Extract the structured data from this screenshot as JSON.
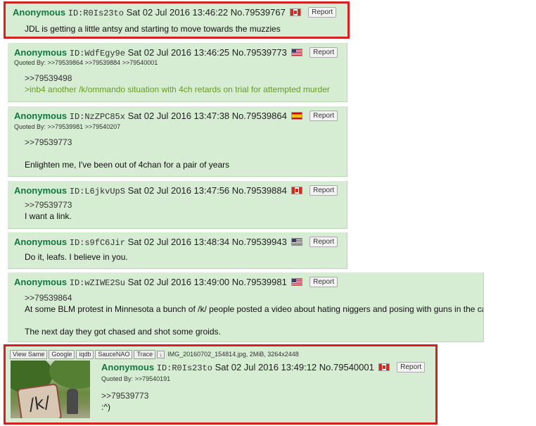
{
  "report_label": "Report",
  "quoted_by_label": "Quoted By:",
  "posts": [
    {
      "name": "Anonymous",
      "id": "ID:R0Is23to",
      "date": "Sat 02 Jul 2016 13:46:22",
      "no": "No.79539767",
      "flag": "canada-flag-icon",
      "lines": [
        "JDL is getting a little antsy and starting to move towards the muzzies"
      ]
    },
    {
      "name": "Anonymous",
      "id": "ID:WdfEgy9e",
      "date": "Sat 02 Jul 2016 13:46:25",
      "no": "No.79539773",
      "flag": "us-flag-icon",
      "quoted_by": [
        ">>79539864",
        ">>79539884",
        ">>79540001"
      ],
      "lines": [
        ">>79539498",
        ">inb4 another /k/ommando situation with 4ch retards on trial for attempted murder"
      ]
    },
    {
      "name": "Anonymous",
      "id": "ID:NzZPC85x",
      "date": "Sat 02 Jul 2016 13:47:38",
      "no": "No.79539864",
      "flag": "spain-flag-icon",
      "quoted_by": [
        ">>79539981",
        ">>79540207"
      ],
      "lines": [
        ">>79539773",
        "Enlighten me, I've been out of 4chan for a pair of years"
      ]
    },
    {
      "name": "Anonymous",
      "id": "ID:L6jkvUpS",
      "date": "Sat 02 Jul 2016 13:47:56",
      "no": "No.79539884",
      "flag": "canada-flag-icon",
      "lines": [
        ">>79539773",
        "I want a link."
      ]
    },
    {
      "name": "Anonymous",
      "id": "ID:s9fC6Jir",
      "date": "Sat 02 Jul 2016 13:48:34",
      "no": "No.79539943",
      "flag": "us-flag-icon",
      "lines": [
        "Do it, leafs. I believe in you."
      ]
    },
    {
      "name": "Anonymous",
      "id": "ID:wZIWE2Su",
      "date": "Sat 02 Jul 2016 13:49:00",
      "no": "No.79539981",
      "flag": "us-flag-icon",
      "lines": [
        ">>79539864",
        "At some BLM protest in Minnesota a bunch of /k/ people posted a video about hating niggers and posing with guns in the car.",
        "The next day they got chased and shot some groids."
      ]
    },
    {
      "name": "Anonymous",
      "id": "ID:R0Is23to",
      "date": "Sat 02 Jul 2016 13:49:12",
      "no": "No.79540001",
      "flag": "canada-flag-icon",
      "quoted_by": [
        ">>79540191"
      ],
      "lines": [
        ">>79539773",
        ":^)"
      ],
      "tools": [
        "View Same",
        "Google",
        "iqdb",
        "SauceNAO",
        "Trace"
      ],
      "file": "IMG_20160702_154814.jpg, 2MiB, 3264x2448",
      "thumb_text": "/k/"
    }
  ]
}
